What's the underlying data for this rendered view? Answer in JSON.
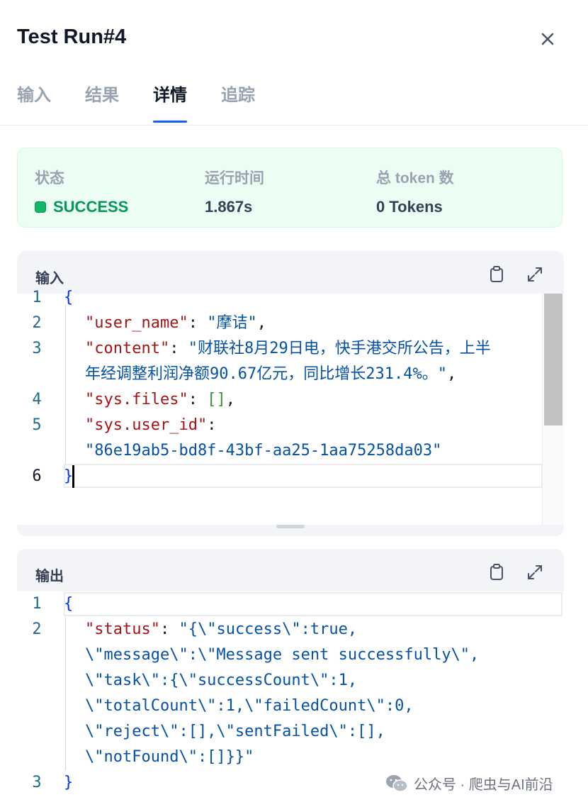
{
  "header": {
    "title": "Test Run#4",
    "tabs": [
      {
        "label": "输入",
        "active": false
      },
      {
        "label": "结果",
        "active": false
      },
      {
        "label": "详情",
        "active": true
      },
      {
        "label": "追踪",
        "active": false
      }
    ],
    "close_icon": "close-icon"
  },
  "status": {
    "status_label": "状态",
    "status_value": "SUCCESS",
    "time_label": "运行时间",
    "time_value": "1.867s",
    "token_label": "总 token 数",
    "token_value": "0 Tokens"
  },
  "input_panel": {
    "title": "输入",
    "line_numbers": [
      "1",
      "2",
      "3",
      "4",
      "5",
      "6"
    ],
    "lines": {
      "l1": "{",
      "l2_key": "\"user_name\"",
      "l2_val": "\"摩诘\"",
      "l3_key": "\"content\"",
      "l3_val_a": "\"财联社8月29日电，快手港交所公告，上半",
      "l3_val_b": "年经调整利润净额90.67亿元，同比增长231.4%。\"",
      "l4_key": "\"sys.files\"",
      "l4_val": "[]",
      "l5_key": "\"sys.user_id\"",
      "l5_val": "\"86e19ab5-bd8f-43bf-aa25-1aa75258da03\"",
      "l6": "}"
    }
  },
  "output_panel": {
    "title": "输出",
    "line_numbers": [
      "1",
      "2",
      "3"
    ],
    "lines": {
      "l1": "{",
      "l2_key": "\"status\"",
      "l2_val_a": "\"{\\\"success\\\":true,",
      "l2_val_b": "\\\"message\\\":\\\"Message sent successfully\\\",",
      "l2_val_c": "\\\"task\\\":{\\\"successCount\\\":1,",
      "l2_val_d": "\\\"totalCount\\\":1,\\\"failedCount\\\":0,",
      "l2_val_e": "\\\"reject\\\":[],\\\"sentFailed\\\":[],",
      "l2_val_f": "\\\"notFound\\\":[]}}\"",
      "l3": "}"
    }
  },
  "watermark": "公众号 · 爬虫与AI前沿",
  "colors": {
    "accent": "#155eef",
    "success": "#039855",
    "success_bg": "#ecfdf3",
    "json_key": "#a31515",
    "json_string": "#0451a5"
  }
}
